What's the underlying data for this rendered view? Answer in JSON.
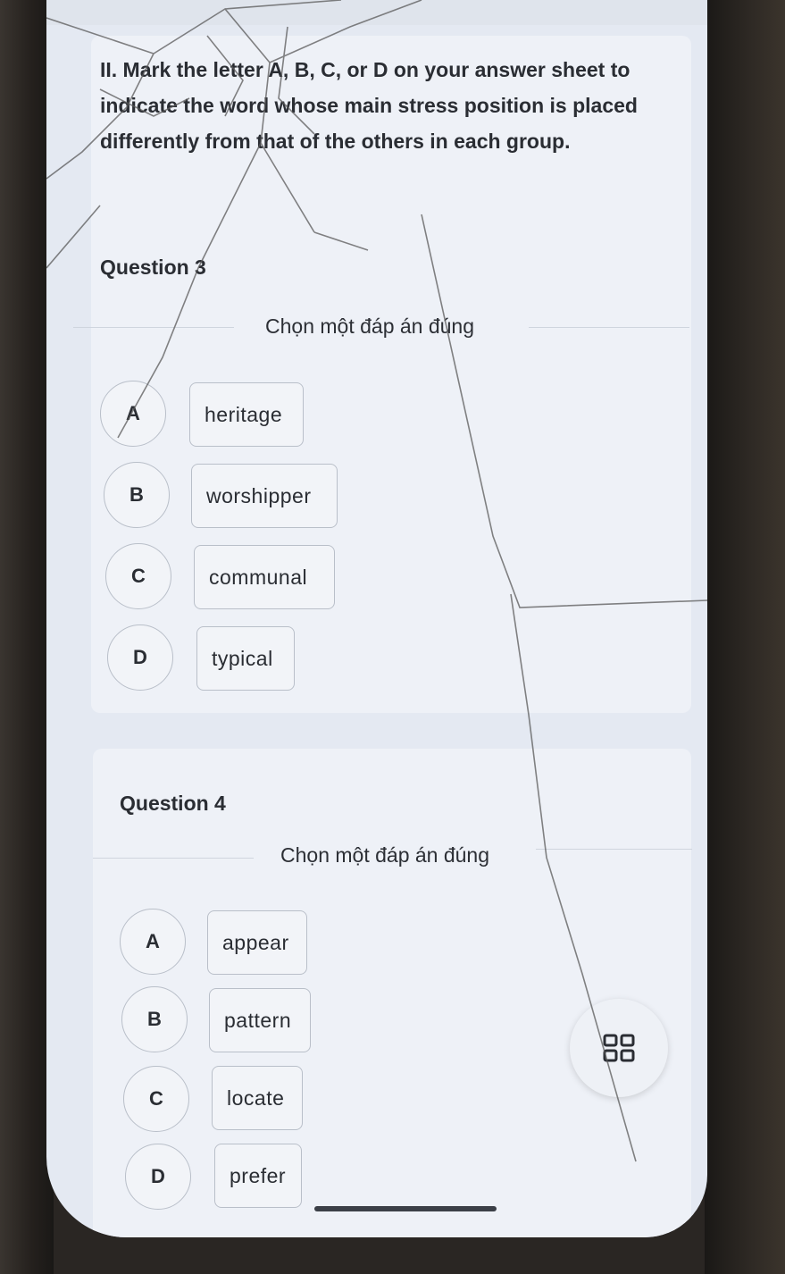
{
  "instruction": "II. Mark the letter A, B, C, or D on your answer sheet to indicate the word whose main stress position is placed differently from that of the others in each group.",
  "questions": [
    {
      "title": "Question 3",
      "prompt": "Chọn một đáp án đúng",
      "options": [
        {
          "letter": "A",
          "text": "heritage"
        },
        {
          "letter": "B",
          "text": "worshipper"
        },
        {
          "letter": "C",
          "text": "communal"
        },
        {
          "letter": "D",
          "text": "typical"
        }
      ]
    },
    {
      "title": "Question 4",
      "prompt": "Chọn một đáp án đúng",
      "options": [
        {
          "letter": "A",
          "text": "appear"
        },
        {
          "letter": "B",
          "text": "pattern"
        },
        {
          "letter": "C",
          "text": "locate"
        },
        {
          "letter": "D",
          "text": "prefer"
        }
      ]
    }
  ],
  "menu_button": {
    "icon": "grid-menu-icon"
  },
  "colors": {
    "screen": "#e4e9f2",
    "card": "#eef1f7",
    "border": "#b9bfc9",
    "text": "#2a2d33"
  }
}
